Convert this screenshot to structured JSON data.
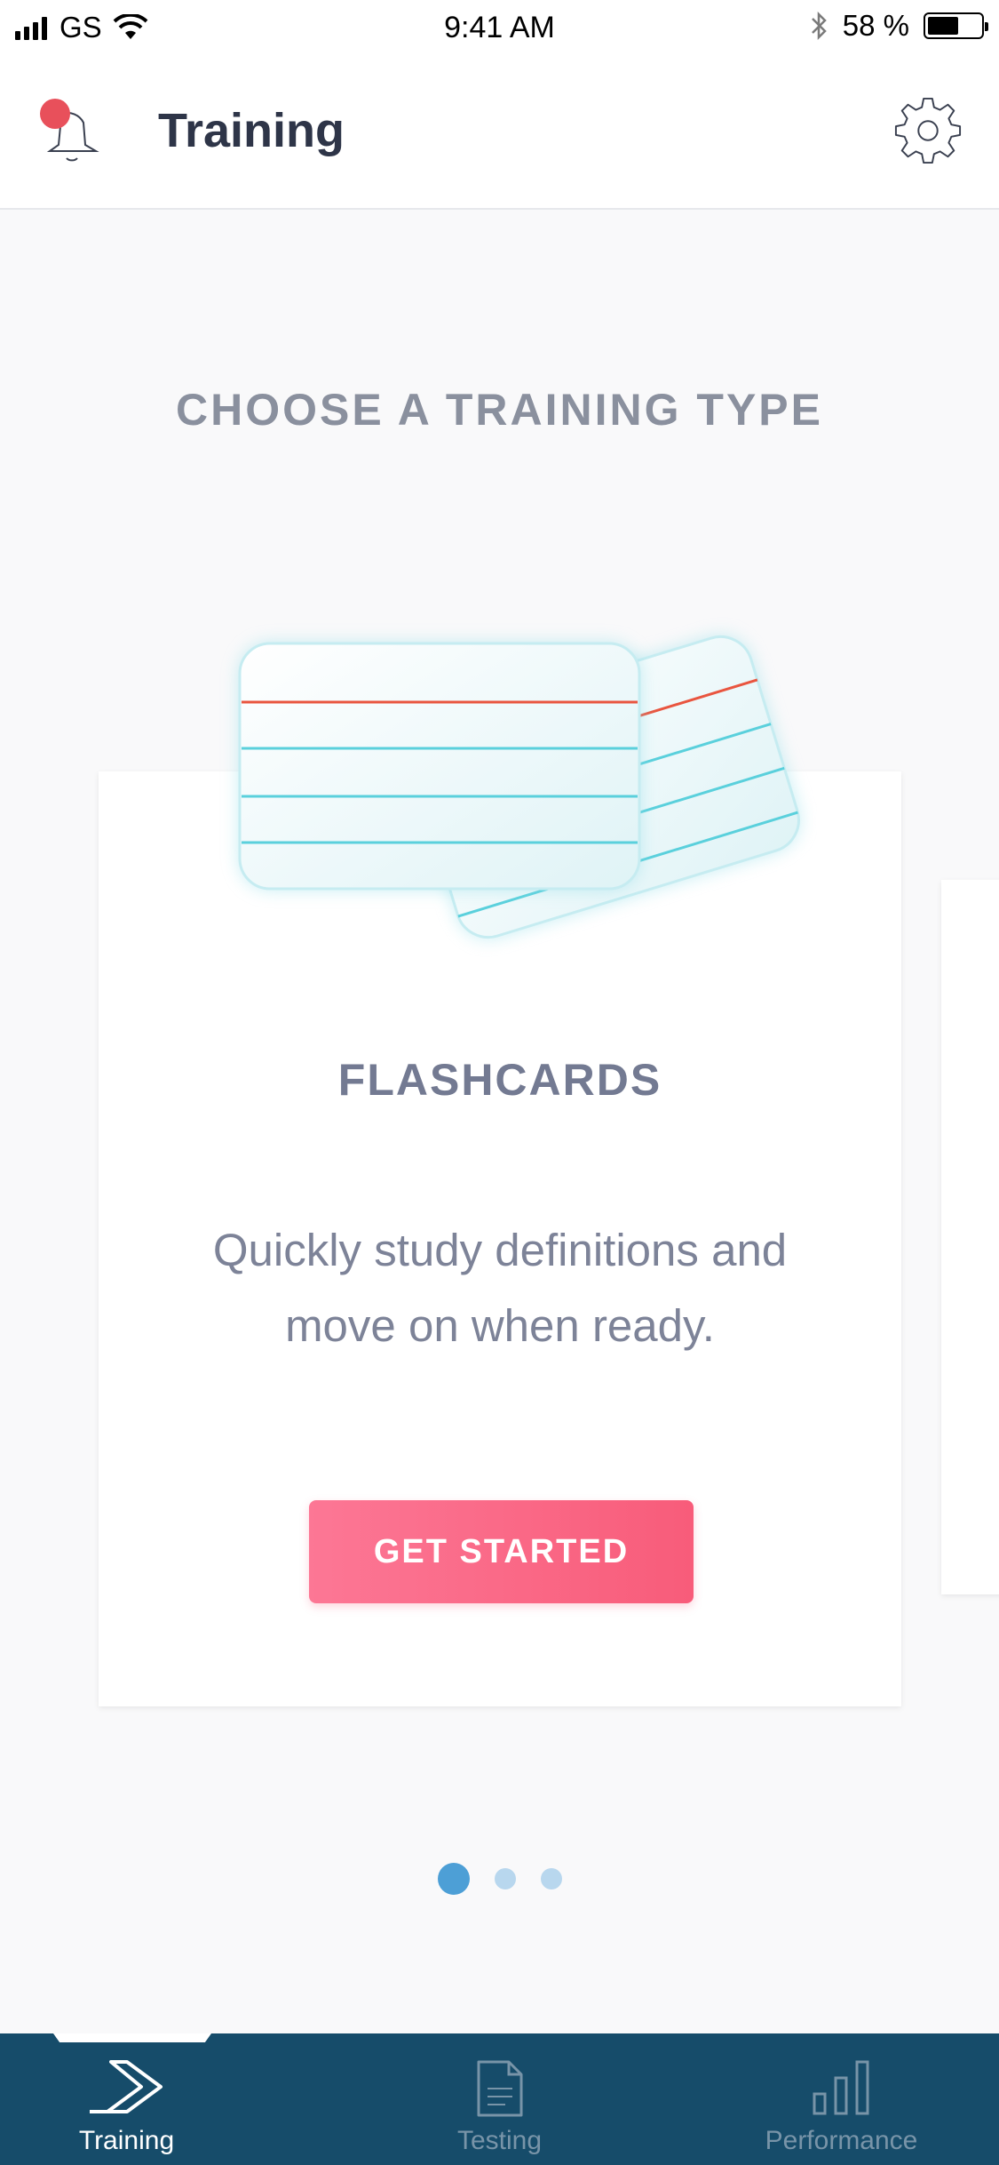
{
  "status_bar": {
    "carrier": "GS",
    "time": "9:41 AM",
    "battery_percent": "58 %",
    "battery_level": 0.58
  },
  "header": {
    "title": "Training",
    "notification_icon": "bell-icon",
    "settings_icon": "gear-icon"
  },
  "main": {
    "heading": "CHOOSE A TRAINING TYPE",
    "card": {
      "illustration": "flashcards-illustration",
      "title": "FLASHCARDS",
      "description": "Quickly study definitions and move on when ready.",
      "button_label": "GET STARTED"
    },
    "pager": {
      "total": 3,
      "active": 1
    }
  },
  "tab_bar": {
    "tabs": [
      {
        "label": "Training",
        "icon": "chevron-icon",
        "active": true
      },
      {
        "label": "Testing",
        "icon": "document-icon",
        "active": false
      },
      {
        "label": "Performance",
        "icon": "bar-chart-icon",
        "active": false
      }
    ]
  },
  "colors": {
    "accent": "#f85c7a",
    "tab_bar": "#164c6a",
    "notification_dot": "#e8505b",
    "pager_active": "#4d9fd6",
    "pager_inactive": "#b8d7ee"
  }
}
